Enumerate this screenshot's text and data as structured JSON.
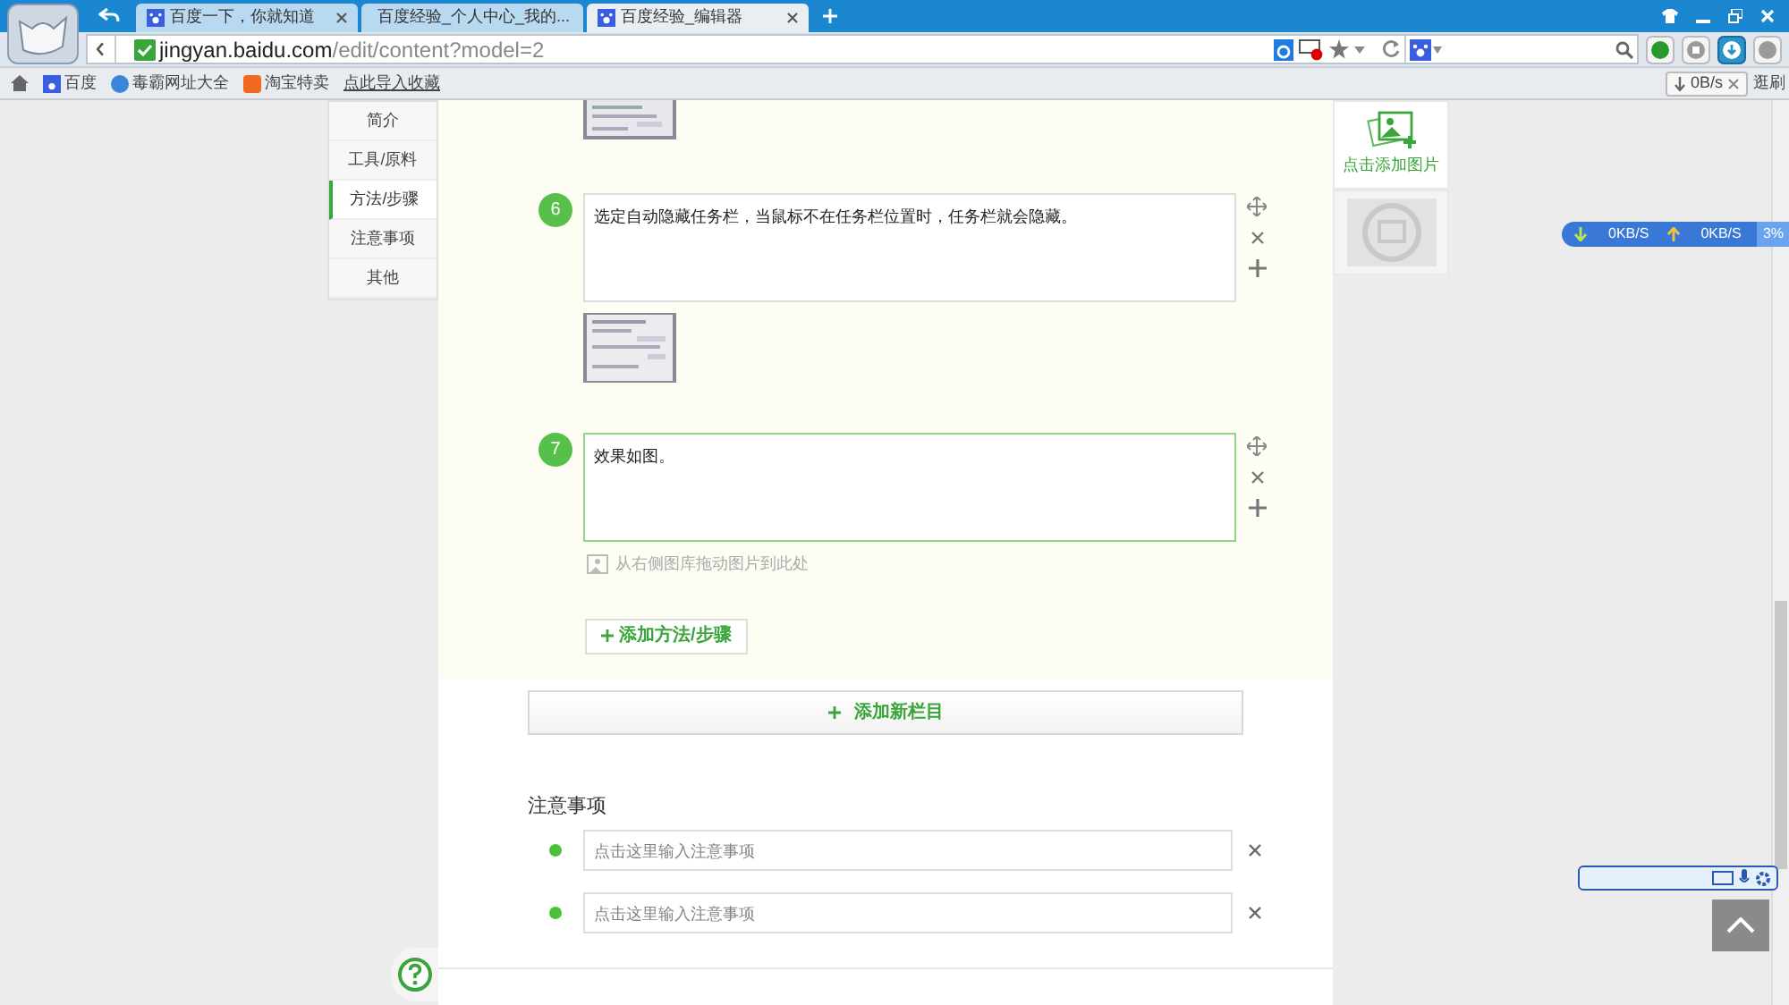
{
  "browser": {
    "tabs": [
      {
        "label": "百度一下，你就知道",
        "selected": false
      },
      {
        "label": "百度经验_个人中心_我的...",
        "selected": false
      },
      {
        "label": "百度经验_编辑器",
        "selected": true
      }
    ],
    "address": {
      "domain": "jingyan.baidu.com",
      "path": "/edit/content?model=2"
    },
    "bookmarks": [
      "百度",
      "毒霸网址大全",
      "淘宝特卖",
      "点此导入收藏"
    ],
    "download_speed": "0B/s",
    "side_label": "逛刷"
  },
  "network_meter": {
    "down": "0KB/S",
    "up": "0KB/S",
    "percent": "3%"
  },
  "sidebar": {
    "items": [
      {
        "label": "简介",
        "selected": false
      },
      {
        "label": "工具/原料",
        "selected": false
      },
      {
        "label": "方法/步骤",
        "selected": true
      },
      {
        "label": "注意事项",
        "selected": false
      },
      {
        "label": "其他",
        "selected": false
      }
    ]
  },
  "steps": [
    {
      "number": "6",
      "text": "选定自动隐藏任务栏，当鼠标不在任务栏位置时，任务栏就会隐藏。",
      "focused": false,
      "has_image": true
    },
    {
      "number": "7",
      "text": "效果如图。",
      "focused": true,
      "has_image": false
    }
  ],
  "image_hint": "从右侧图库拖动图片到此处",
  "add_step_button": "添加方法/步骤",
  "add_section_button": "添加新栏目",
  "notes": {
    "heading": "注意事项",
    "fields": [
      {
        "placeholder": "点击这里输入注意事项"
      },
      {
        "placeholder": "点击这里输入注意事项"
      }
    ]
  },
  "image_panel": {
    "add_label": "点击添加图片"
  }
}
